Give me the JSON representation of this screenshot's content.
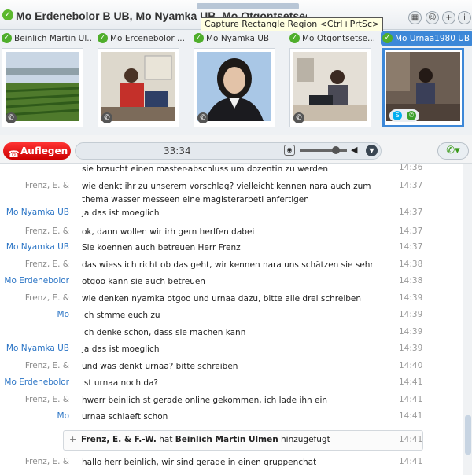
{
  "window": {
    "title": "Mo Erdenebolor B UB, Mo Nyamka UB, Mo Otgontsetseg UB",
    "tooltip": "Capture Rectangle Region <Ctrl+PrtSc>"
  },
  "participants": [
    {
      "name": "Beinlich Martin Ul...",
      "active": false
    },
    {
      "name": "Mo Ercenebolor ...",
      "active": false
    },
    {
      "name": "Mo Nyamka UB",
      "active": false
    },
    {
      "name": "Mo Otgontsetse...",
      "active": false
    },
    {
      "name": "Mo Urnaa1980 UB",
      "active": true
    }
  ],
  "callbar": {
    "hangup_label": "Auflegen",
    "timer": "33:34"
  },
  "messages": [
    {
      "sender": "",
      "text": "sie braucht einen master-abschluss um dozentin zu werden",
      "time": "14:36",
      "style": "frenz"
    },
    {
      "sender": "Frenz, E. &",
      "text": "wie denkt ihr zu unserem vorschlag? vielleicht kennen nara auch zum thema wasser messeen eine magisterarbeti anfertigen",
      "time": "14:37",
      "style": "frenz"
    },
    {
      "sender": "Mo Nyamka UB",
      "text": "ja das ist moeglich",
      "time": "14:37",
      "style": "blue"
    },
    {
      "sender": "Frenz, E. &",
      "text": "ok, dann wollen wir irh gern herlfen dabei",
      "time": "14:37",
      "style": "frenz"
    },
    {
      "sender": "Mo Nyamka UB",
      "text": "Sie koennen auch betreuen Herr Frenz",
      "time": "14:37",
      "style": "blue"
    },
    {
      "sender": "Frenz, E. &",
      "text": "das wiess ich richt ob das geht, wir kennen nara uns schätzen sie sehr",
      "time": "14:38",
      "style": "frenz"
    },
    {
      "sender": "Mo Erdenebolor",
      "text": "otgoo kann sie auch betreuen",
      "time": "14:38",
      "style": "blue"
    },
    {
      "sender": "Frenz, E. &",
      "text": "wie denken nyamka otgoo und urnaa dazu, bitte alle drei schreiben",
      "time": "14:39",
      "style": "frenz"
    },
    {
      "sender": "Mo",
      "text": "ich stmme euch zu",
      "time": "14:39",
      "style": "blue"
    },
    {
      "sender": "",
      "text": "ich denke schon, dass sie machen kann",
      "time": "14:39",
      "style": "blue"
    },
    {
      "sender": "Mo Nyamka UB",
      "text": "ja das ist moeglich",
      "time": "14:39",
      "style": "blue"
    },
    {
      "sender": "Frenz, E. &",
      "text": "und was denkt urnaa? bitte schreiben",
      "time": "14:40",
      "style": "frenz"
    },
    {
      "sender": "Mo Erdenebolor",
      "text": "ist urnaa noch da?",
      "time": "14:41",
      "style": "blue"
    },
    {
      "sender": "Frenz, E. &",
      "text": "hwerr beinlich st gerade online gekommen, ich lade ihn ein",
      "time": "14:41",
      "style": "frenz"
    },
    {
      "sender": "Mo",
      "text": "urnaa schlaeft schon",
      "time": "14:41",
      "style": "blue"
    }
  ],
  "system_message": {
    "actor": "Frenz, E. & F.-W.",
    "verb": "hat",
    "target": "Beinlich Martin Ulmen",
    "suffix": "hinzugefügt",
    "time": "14:41"
  },
  "last_message": {
    "sender": "Frenz, E. &",
    "text": "hallo herr beinlich, wir sind gerade in einen gruppenchat",
    "time": "14:41"
  }
}
